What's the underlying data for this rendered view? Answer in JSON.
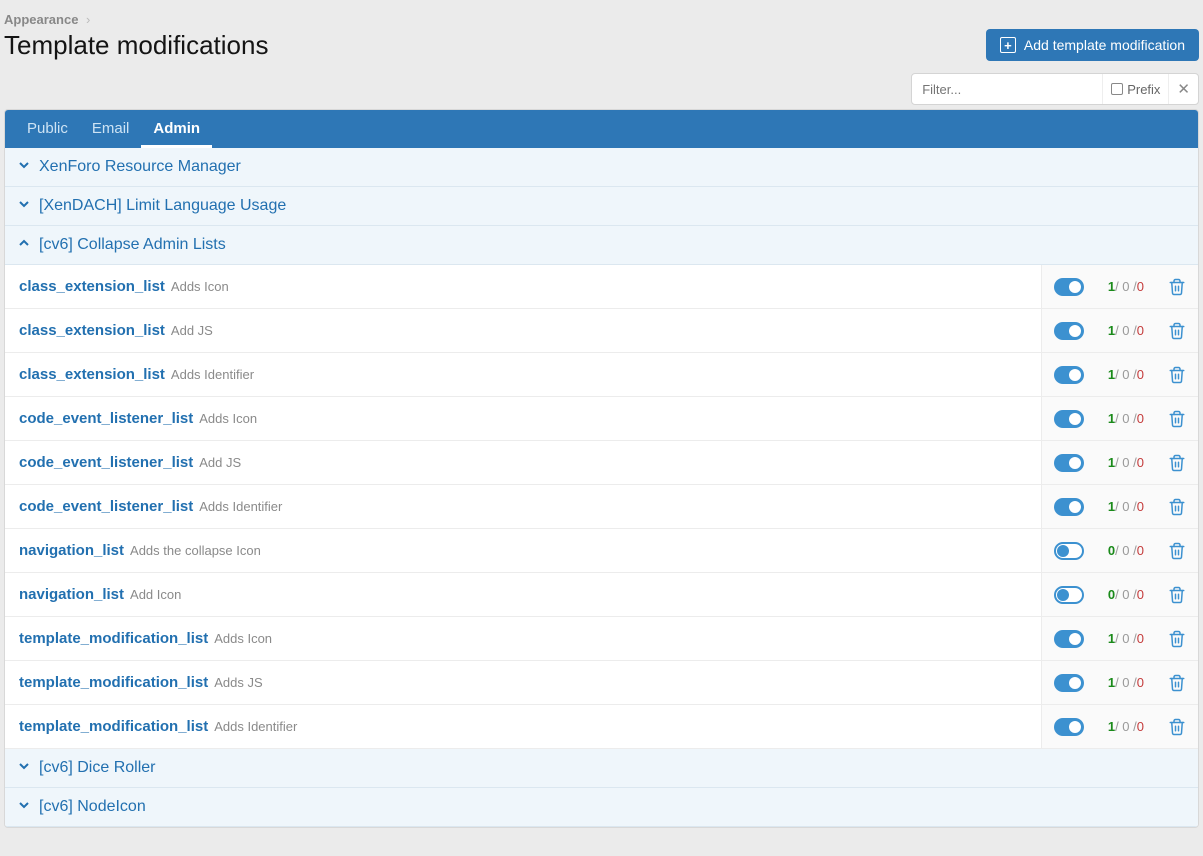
{
  "breadcrumb": {
    "item": "Appearance"
  },
  "page_title": "Template modifications",
  "add_button_label": "Add template modification",
  "filter": {
    "placeholder": "Filter...",
    "prefix_label": "Prefix"
  },
  "tabs": [
    {
      "label": "Public",
      "active": false
    },
    {
      "label": "Email",
      "active": false
    },
    {
      "label": "Admin",
      "active": true
    }
  ],
  "sections": [
    {
      "title": "XenForo Resource Manager",
      "expanded": false,
      "items": []
    },
    {
      "title": "[XenDACH] Limit Language Usage",
      "expanded": false,
      "items": []
    },
    {
      "title": "[cv6] Collapse Admin Lists",
      "expanded": true,
      "items": [
        {
          "name": "class_extension_list",
          "desc": "Adds Icon",
          "enabled": true,
          "stats": {
            "a": 1,
            "b": 0,
            "c": 0
          }
        },
        {
          "name": "class_extension_list",
          "desc": "Add JS",
          "enabled": true,
          "stats": {
            "a": 1,
            "b": 0,
            "c": 0
          }
        },
        {
          "name": "class_extension_list",
          "desc": "Adds Identifier",
          "enabled": true,
          "stats": {
            "a": 1,
            "b": 0,
            "c": 0
          }
        },
        {
          "name": "code_event_listener_list",
          "desc": "Adds Icon",
          "enabled": true,
          "stats": {
            "a": 1,
            "b": 0,
            "c": 0
          }
        },
        {
          "name": "code_event_listener_list",
          "desc": "Add JS",
          "enabled": true,
          "stats": {
            "a": 1,
            "b": 0,
            "c": 0
          }
        },
        {
          "name": "code_event_listener_list",
          "desc": "Adds Identifier",
          "enabled": true,
          "stats": {
            "a": 1,
            "b": 0,
            "c": 0
          }
        },
        {
          "name": "navigation_list",
          "desc": "Adds the collapse Icon",
          "enabled": false,
          "stats": {
            "a": 0,
            "b": 0,
            "c": 0
          }
        },
        {
          "name": "navigation_list",
          "desc": "Add Icon",
          "enabled": false,
          "stats": {
            "a": 0,
            "b": 0,
            "c": 0
          }
        },
        {
          "name": "template_modification_list",
          "desc": "Adds Icon",
          "enabled": true,
          "stats": {
            "a": 1,
            "b": 0,
            "c": 0
          }
        },
        {
          "name": "template_modification_list",
          "desc": "Adds JS",
          "enabled": true,
          "stats": {
            "a": 1,
            "b": 0,
            "c": 0
          }
        },
        {
          "name": "template_modification_list",
          "desc": "Adds Identifier",
          "enabled": true,
          "stats": {
            "a": 1,
            "b": 0,
            "c": 0
          }
        }
      ]
    },
    {
      "title": "[cv6] Dice Roller",
      "expanded": false,
      "items": []
    },
    {
      "title": "[cv6] NodeIcon",
      "expanded": false,
      "items": []
    }
  ]
}
